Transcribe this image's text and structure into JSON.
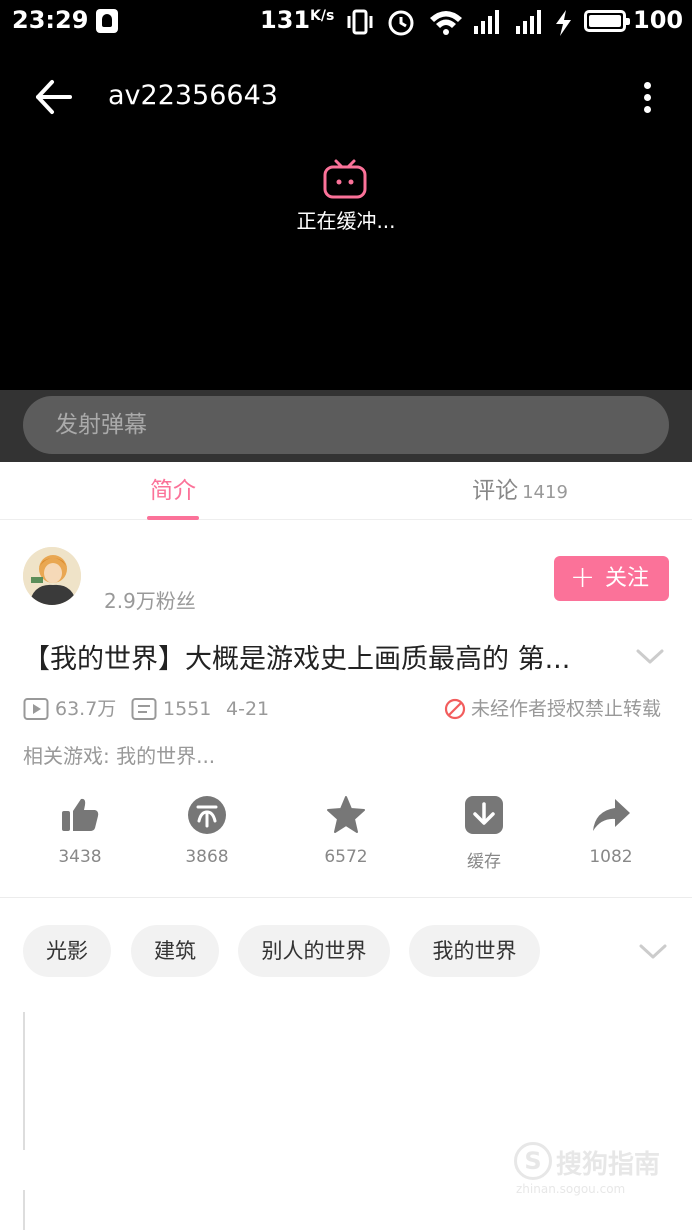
{
  "status_bar": {
    "time": "23:29",
    "net_speed": "131",
    "net_unit": "K/s",
    "battery_level": "100"
  },
  "player": {
    "title": "av22356643",
    "buffering_text": "正在缓冲...",
    "danmaku_placeholder": "发射弹幕"
  },
  "tabs": [
    {
      "label": "简介",
      "active": true
    },
    {
      "label": "评论",
      "count": "1419",
      "active": false
    }
  ],
  "uploader": {
    "fans": "2.9万粉丝",
    "follow_plus": "+",
    "follow_label": "关注"
  },
  "video": {
    "title": "【我的世界】大概是游戏史上画质最高的 第...",
    "plays": "63.7万",
    "danmaku_count": "1551",
    "date": "4-21",
    "repost_notice": "未经作者授权禁止转载",
    "related_game": "相关游戏: 我的世界..."
  },
  "actions": [
    {
      "icon": "thumbs-up-icon",
      "label": "3438"
    },
    {
      "icon": "coin-icon",
      "label": "3868"
    },
    {
      "icon": "star-icon",
      "label": "6572"
    },
    {
      "icon": "download-icon",
      "label": "缓存"
    },
    {
      "icon": "share-icon",
      "label": "1082"
    }
  ],
  "tags": [
    "光影",
    "建筑",
    "别人的世界",
    "我的世界"
  ],
  "watermark": {
    "text": "搜狗指南",
    "sub": "zhinan.sogou.com"
  },
  "colors": {
    "accent": "#fb7299",
    "player_bg": "#000000",
    "danmaku_bar": "#333333"
  }
}
